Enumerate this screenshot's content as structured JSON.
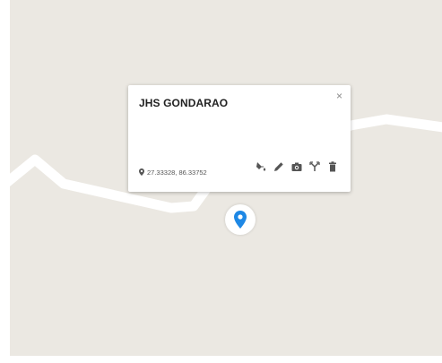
{
  "popup": {
    "title": "JHS GONDARAO",
    "close_symbol": "×",
    "coordinates": "27.33328, 86.33752"
  },
  "toolbar": {
    "icons": [
      "paint-bucket-icon",
      "pencil-icon",
      "camera-icon",
      "route-icon",
      "trash-icon"
    ]
  },
  "colors": {
    "map_background": "#ebe8e2",
    "road": "#ffffff",
    "marker": "#1e88e5"
  }
}
